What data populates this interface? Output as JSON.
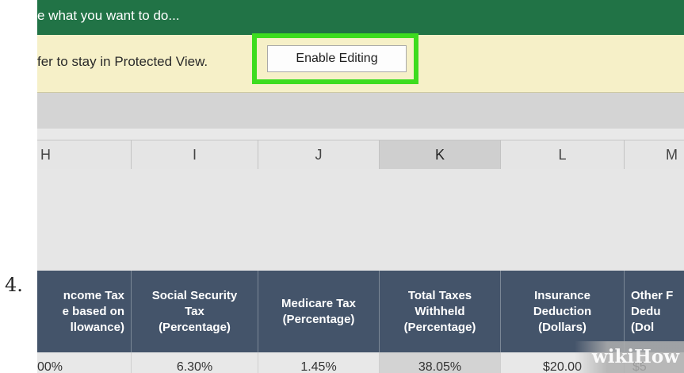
{
  "step_number": "4.",
  "tellme": {
    "text": "e what you want to do..."
  },
  "protected_view": {
    "message": "fer to stay in Protected View.",
    "enable_button": "Enable Editing"
  },
  "colors": {
    "ribbon_green": "#217346",
    "message_bar": "#f6f0c8",
    "highlight": "#3ddc1f",
    "table_header": "#44546a"
  },
  "columns": [
    {
      "label": "H",
      "selected": false
    },
    {
      "label": "I",
      "selected": false
    },
    {
      "label": "J",
      "selected": false
    },
    {
      "label": "K",
      "selected": true
    },
    {
      "label": "L",
      "selected": false
    },
    {
      "label": "M",
      "selected": false
    }
  ],
  "table_headers": [
    "ncome Tax\ne based on\nllowance)",
    "Social Security\nTax\n(Percentage)",
    "Medicare Tax\n(Percentage)",
    "Total Taxes\nWithheld\n(Percentage)",
    "Insurance\nDeduction\n(Dollars)",
    "Other F\nDedu\n(Dol"
  ],
  "data_row": [
    "00%",
    "6.30%",
    "1.45%",
    "38.05%",
    "$20.00",
    "$5"
  ],
  "watermark": "wikiHow"
}
